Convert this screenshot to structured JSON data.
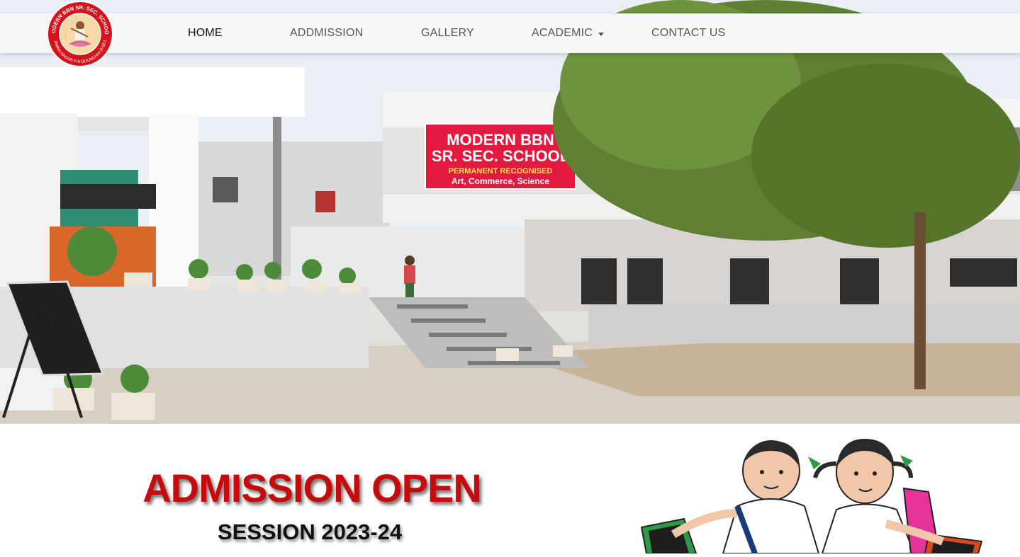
{
  "nav": {
    "items": [
      {
        "label": "HOME",
        "active": true
      },
      {
        "label": "ADDMISSION",
        "active": false
      },
      {
        "label": "GALLERY",
        "active": false
      },
      {
        "label": "ACADEMIC",
        "active": false,
        "has_dropdown": true
      },
      {
        "label": "CONTACT US",
        "active": false
      }
    ]
  },
  "logo": {
    "icon": "school-crest-logo",
    "ring_text_top": "MODERN BBN SR. SEC. SCHOOL",
    "ring_text_bottom": "JIWAN NAGAR P-II GOUNCHHI (F.BD)",
    "colors": {
      "ring": "#d4141c",
      "inner": "#f6d9a8"
    }
  },
  "hero": {
    "signboard": {
      "line1": "MODERN BBN",
      "line2": "SR. SEC. SCHOOL",
      "line3": "PERMANENT RECOGNISED",
      "line4": "Art, Commerce, Science"
    },
    "colors": {
      "sign": "#e3193f",
      "building": "#e6e4e0",
      "tree": "#5f7f33"
    }
  },
  "admission": {
    "title": "ADMISSION OPEN",
    "session": "SESSION 2023-24",
    "illustration": "school-kids-illustration",
    "colors": {
      "title": "#c50b0b"
    }
  }
}
